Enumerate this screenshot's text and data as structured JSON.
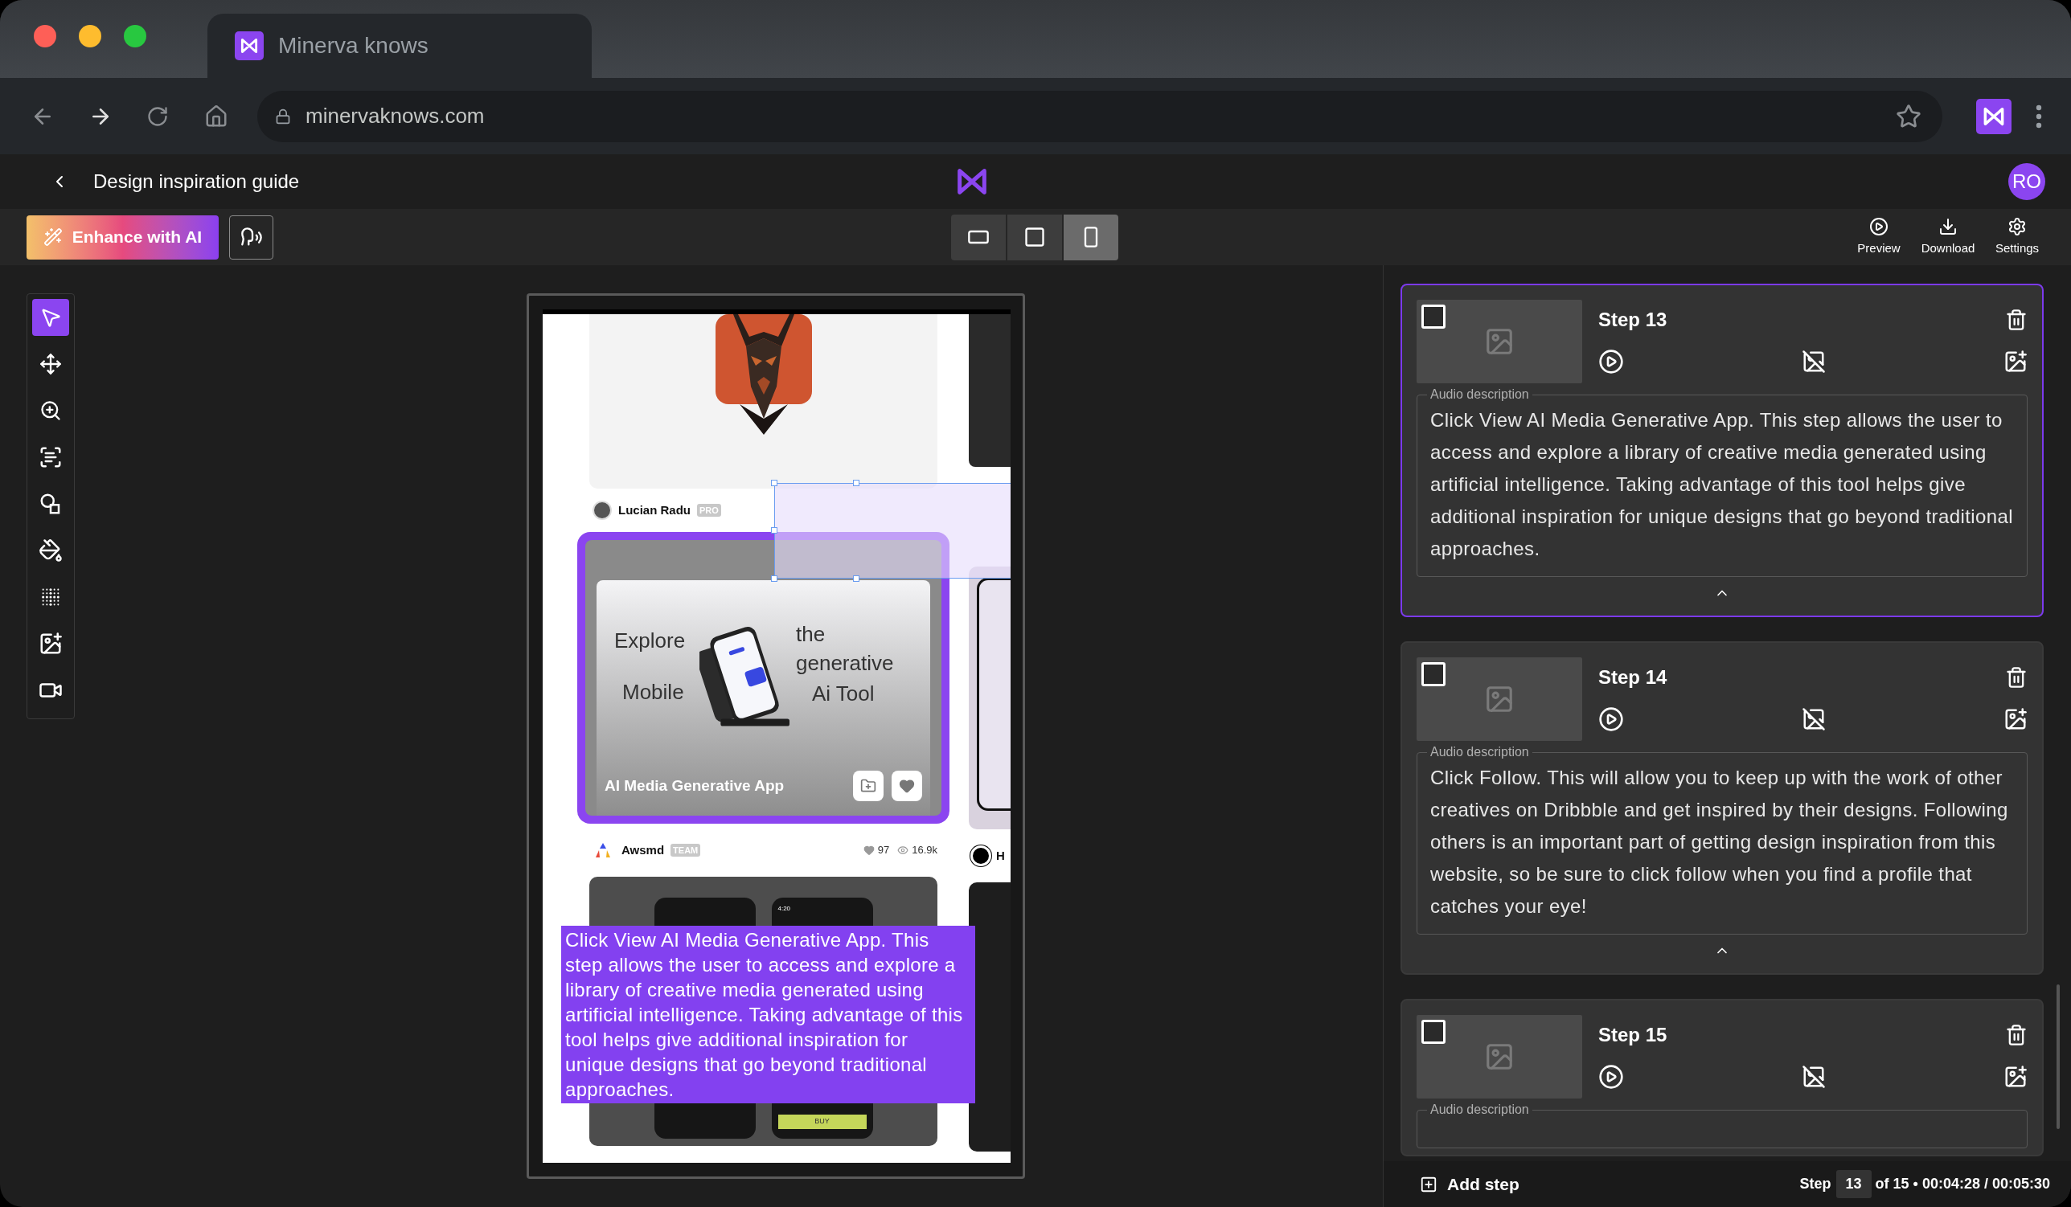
{
  "browser": {
    "tab_title": "Minerva knows",
    "url": "minervaknows.com"
  },
  "header": {
    "title": "Design inspiration guide",
    "avatar": "RO"
  },
  "toolbar": {
    "enhance_button": "Enhance with AI",
    "view_modes": [
      {
        "kind": "landscape",
        "selected": false
      },
      {
        "kind": "square",
        "selected": false
      },
      {
        "kind": "portrait",
        "selected": true
      }
    ],
    "actions": [
      {
        "kind": "preview",
        "label": "Preview"
      },
      {
        "kind": "download",
        "label": "Download"
      },
      {
        "kind": "settings",
        "label": "Settings"
      }
    ]
  },
  "tools": [
    {
      "kind": "select",
      "selected": true
    },
    {
      "kind": "move",
      "selected": false
    },
    {
      "kind": "zoom",
      "selected": false
    },
    {
      "kind": "text",
      "selected": false
    },
    {
      "kind": "shapes",
      "selected": false
    },
    {
      "kind": "fill",
      "selected": false
    },
    {
      "kind": "blur",
      "selected": false
    },
    {
      "kind": "image",
      "selected": false
    },
    {
      "kind": "video",
      "selected": false
    }
  ],
  "canvas": {
    "page": {
      "shot_1": {
        "author": "Lucian Radu",
        "badge": "PRO"
      },
      "shot_2": {
        "highlighted": true,
        "headline": [
          "Explore",
          "the",
          "generative",
          "Mobile",
          "Ai Tool"
        ],
        "title": "AI Media Generative App",
        "author": "Awsmd",
        "badge": "TEAM",
        "likes": "97",
        "views": "16.9k"
      },
      "shot_3": {
        "phone_time": "4:20",
        "phone_button": "BUY"
      },
      "side_author": "H"
    },
    "overlay_text": "Click View AI Media Generative App. This step allows the user to access and explore a library of creative media generated using artificial intelligence. Taking advantage of this tool helps give additional inspiration for unique designs that go beyond traditional approaches."
  },
  "steps": [
    {
      "title": "Step 13",
      "selected": true,
      "checked": false,
      "description_label": "Audio description",
      "description": "Click View AI Media Generative App. This step allows the user to access and explore a library of creative media generated using artificial intelligence. Taking advantage of this tool helps give additional inspiration for unique designs that go beyond traditional approaches.",
      "expanded": true
    },
    {
      "title": "Step 14",
      "selected": false,
      "checked": false,
      "description_label": "Audio description",
      "description": "Click Follow. This will allow you to keep up with the work of other creatives on Dribbble and get inspired by their designs. Following others is an important part of getting design inspiration from this website, so be sure to click follow when you find a profile that catches your eye!",
      "expanded": true
    },
    {
      "title": "Step 15",
      "selected": false,
      "checked": false,
      "description_label": "Audio description"
    }
  ],
  "footer": {
    "add_step": "Add step",
    "step_label": "Step",
    "step_value": "13",
    "summary": "of 15 • 00:04:28 / 00:05:30"
  }
}
